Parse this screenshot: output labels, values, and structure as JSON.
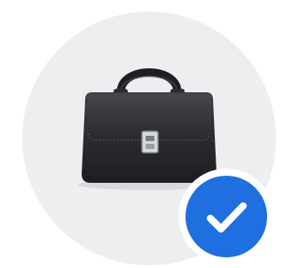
{
  "profile": {
    "icon": "briefcase-icon",
    "background_color": "#eceef0",
    "icon_color": "#2b2d30"
  },
  "badge": {
    "icon": "checkmark-icon",
    "status": "verified",
    "color": "#1f6fe0"
  }
}
